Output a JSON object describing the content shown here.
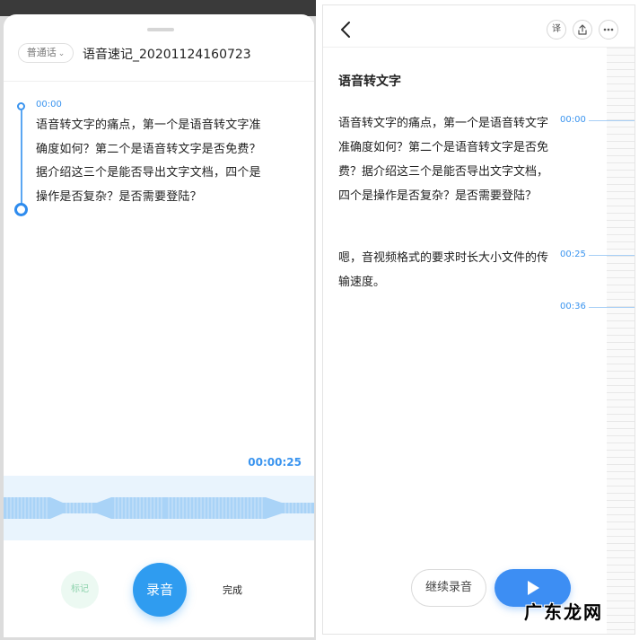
{
  "recorder": {
    "language_chip": "普通话",
    "title": "语音速记_20201124160723",
    "segment_time": "00:00",
    "transcript": "语音转文字的痛点，第一个是语音转文字准确度如何？第二个是语音转文字是否免费？据介绍这三个是能否导出文字文档，四个是操作是否复杂？是否需要登陆？",
    "elapsed": "00:00:25",
    "mark_label": "标记",
    "record_label": "录音",
    "done_label": "完成"
  },
  "viewer": {
    "translate_label": "译",
    "heading": "语音转文字",
    "paragraph1": "语音转文字的痛点，第一个是语音转文字准确度如何？第二个是语音转文字是否免费？据介绍这三个是能否导出文字文档，四个是操作是否复杂？是否需要登陆？",
    "paragraph2": "嗯，音视频格式的要求时长大小文件的传输速度。",
    "timestamps": [
      "00:00",
      "00:25",
      "00:36"
    ],
    "continue_label": "继续录音"
  },
  "watermark": "广东龙网",
  "colors": {
    "accent": "#3a94ef",
    "record_button": "#2f9cf0",
    "play_button": "#3d8ef3",
    "wave": "#a9d3f7",
    "wave_band": "#e9f4fd",
    "mark_bg": "#ecf9f2"
  },
  "icons": {
    "back": "chevron-left-icon",
    "share": "share-icon",
    "more": "more-dots-icon",
    "play": "play-icon",
    "lang_dropdown": "chevron-down-icon"
  }
}
